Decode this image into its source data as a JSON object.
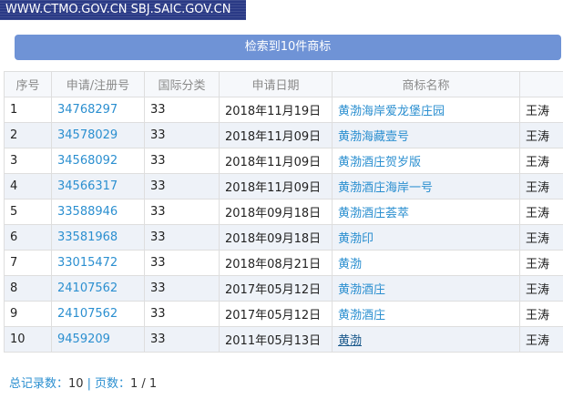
{
  "top_banner": "WWW.CTMO.GOV.CN  SBJ.SAIC.GOV.CN",
  "result_button": "检索到10件商标",
  "table": {
    "headers": [
      "序号",
      "申请/注册号",
      "国际分类",
      "申请日期",
      "商标名称",
      ""
    ],
    "rows": [
      {
        "no": "1",
        "reg": "34768297",
        "cls": "33",
        "date": "2018年11月19日",
        "name": "黄渤海岸爱龙堡庄园",
        "applicant": "王涛"
      },
      {
        "no": "2",
        "reg": "34578029",
        "cls": "33",
        "date": "2018年11月09日",
        "name": "黄渤海藏壹号",
        "applicant": "王涛"
      },
      {
        "no": "3",
        "reg": "34568092",
        "cls": "33",
        "date": "2018年11月09日",
        "name": "黄渤酒庄贺岁版",
        "applicant": "王涛"
      },
      {
        "no": "4",
        "reg": "34566317",
        "cls": "33",
        "date": "2018年11月09日",
        "name": "黄渤酒庄海岸一号",
        "applicant": "王涛"
      },
      {
        "no": "5",
        "reg": "33588946",
        "cls": "33",
        "date": "2018年09月18日",
        "name": "黄渤酒庄荟萃",
        "applicant": "王涛"
      },
      {
        "no": "6",
        "reg": "33581968",
        "cls": "33",
        "date": "2018年09月18日",
        "name": "黄渤印",
        "applicant": "王涛"
      },
      {
        "no": "7",
        "reg": "33015472",
        "cls": "33",
        "date": "2018年08月21日",
        "name": "黄渤",
        "applicant": "王涛"
      },
      {
        "no": "8",
        "reg": "24107562",
        "cls": "33",
        "date": "2017年05月12日",
        "name": "黄渤酒庄",
        "applicant": "王涛"
      },
      {
        "no": "9",
        "reg": "24107562",
        "cls": "33",
        "date": "2017年05月12日",
        "name": "黄渤酒庄",
        "applicant": "王涛"
      },
      {
        "no": "10",
        "reg": "9459209",
        "cls": "33",
        "date": "2011年05月13日",
        "name": "黄渤",
        "applicant": "王涛"
      }
    ]
  },
  "footer": {
    "total_label": "总记录数：",
    "total_value": "10",
    "separator": "|",
    "pages_label": "页数：",
    "pages_value": "1 / 1"
  }
}
